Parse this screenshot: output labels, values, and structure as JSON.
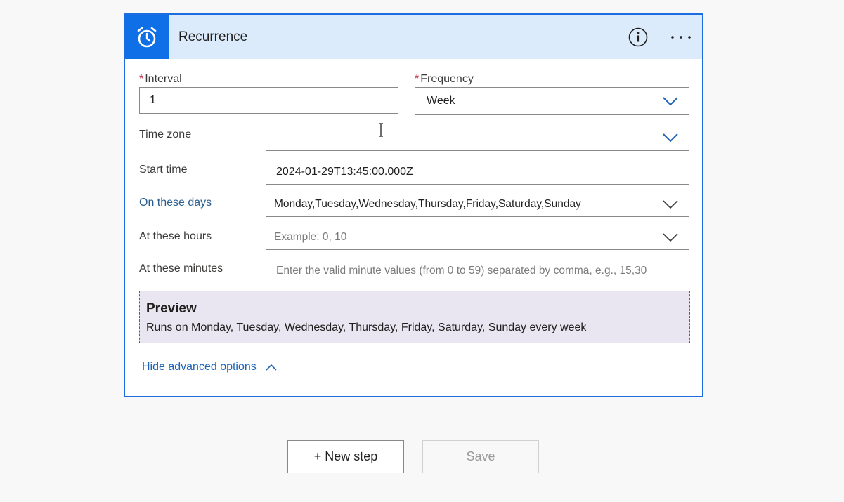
{
  "card": {
    "title": "Recurrence",
    "icon": "alarm-clock-icon",
    "accent_color": "#0f6fe6",
    "header_bg": "#dcebfb"
  },
  "fields": {
    "interval": {
      "label": "Interval",
      "required": true,
      "value": "1"
    },
    "frequency": {
      "label": "Frequency",
      "required": true,
      "value": "Week"
    },
    "time_zone": {
      "label": "Time zone",
      "value": ""
    },
    "start_time": {
      "label": "Start time",
      "value": "2024-01-29T13:45:00.000Z"
    },
    "on_these_days": {
      "label": "On these days",
      "value": "Monday,Tuesday,Wednesday,Thursday,Friday,Saturday,Sunday"
    },
    "at_these_hours": {
      "label": "At these hours",
      "placeholder": "Example: 0, 10"
    },
    "at_these_minutes": {
      "label": "At these minutes",
      "placeholder": "Enter the valid minute values (from 0 to 59) separated by comma, e.g., 15,30"
    }
  },
  "preview": {
    "title": "Preview",
    "text": "Runs on Monday, Tuesday, Wednesday, Thursday, Friday, Saturday, Sunday every week"
  },
  "advanced": {
    "label": "Hide advanced options"
  },
  "actions": {
    "new_step": "+ New step",
    "save": "Save"
  }
}
